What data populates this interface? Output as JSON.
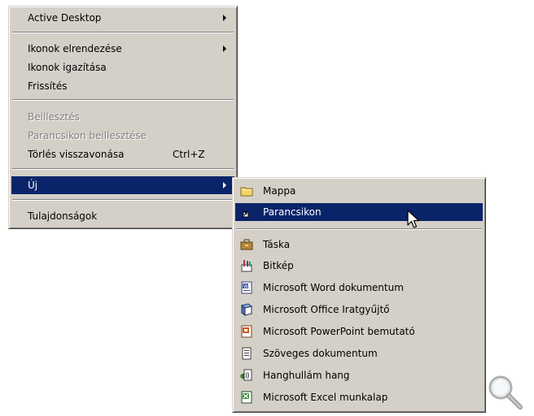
{
  "context_menu": {
    "items": [
      {
        "label": "Active Desktop"
      },
      {
        "label": "Ikonok elrendezése"
      },
      {
        "label": "Ikonok igazítása"
      },
      {
        "label": "Frissítés"
      },
      {
        "label": "Beillesztés"
      },
      {
        "label": "Parancsikon beillesztése"
      },
      {
        "label": "Törlés visszavonása",
        "shortcut": "Ctrl+Z"
      },
      {
        "label": "Új"
      },
      {
        "label": "Tulajdonságok"
      }
    ]
  },
  "submenu": {
    "items": [
      {
        "label": "Mappa",
        "icon": "folder-icon"
      },
      {
        "label": "Parancsikon",
        "icon": "shortcut-icon"
      },
      {
        "label": "Táska",
        "icon": "briefcase-icon"
      },
      {
        "label": "Bitkép",
        "icon": "paint-icon"
      },
      {
        "label": "Microsoft Word dokumentum",
        "icon": "word-icon"
      },
      {
        "label": "Microsoft Office Iratgyűjtő",
        "icon": "binder-icon"
      },
      {
        "label": "Microsoft PowerPoint bemutató",
        "icon": "powerpoint-icon"
      },
      {
        "label": "Szöveges dokumentum",
        "icon": "text-document-icon"
      },
      {
        "label": "Hanghullám hang",
        "icon": "sound-icon"
      },
      {
        "label": "Microsoft Excel munkalap",
        "icon": "excel-icon"
      }
    ]
  },
  "colors": {
    "menu_bg": "#d4d0c8",
    "highlight": "#0a246a",
    "disabled_text": "#808080"
  }
}
